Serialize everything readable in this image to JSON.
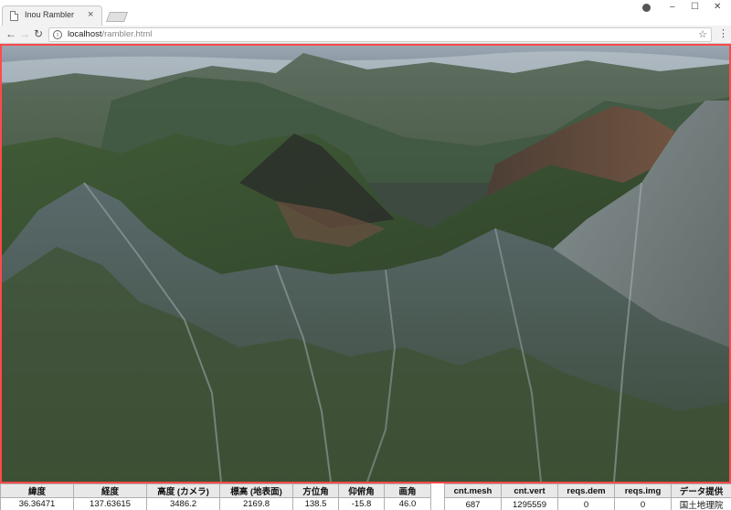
{
  "browser": {
    "tab_title": "Inou Rambler",
    "tab_close": "×",
    "url_host": "localhost",
    "url_path": "/rambler.html",
    "window_controls": {
      "profile": "profile-icon",
      "minimize": "–",
      "maximize": "☐",
      "close": "✕"
    },
    "nav": {
      "back": "←",
      "forward": "→",
      "reload": "↻",
      "info": "i",
      "star": "☆",
      "menu": "⋮"
    }
  },
  "viewport": {
    "border_color": "#ff4a4a",
    "description_icon": "3d-terrain-render"
  },
  "camera_table": {
    "headers": [
      "緯度",
      "経度",
      "高度 (カメラ)",
      "標高 (地表面)",
      "方位角",
      "仰俯角",
      "画角"
    ],
    "values": [
      "36.36471",
      "137.63615",
      "3486.2",
      "2169.8",
      "138.5",
      "-15.8",
      "46.0"
    ]
  },
  "stats_table": {
    "headers": [
      "cnt.mesh",
      "cnt.vert",
      "reqs.dem",
      "reqs.img",
      "データ提供"
    ],
    "values": [
      "687",
      "1295559",
      "0",
      "0",
      "国土地理院"
    ]
  }
}
